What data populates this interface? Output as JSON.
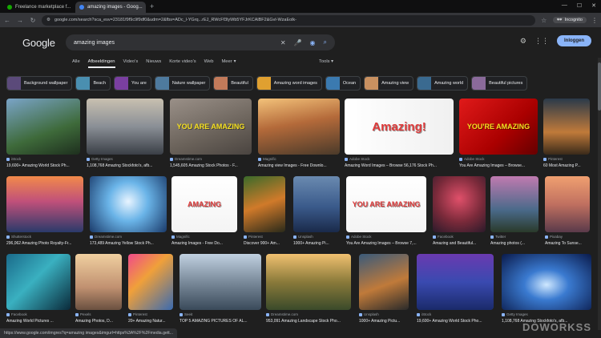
{
  "browser": {
    "tabs": [
      {
        "title": "Freelance marketplace f...",
        "favicon_color": "#14a800",
        "active": false
      },
      {
        "title": "amazing images - Goog...",
        "favicon_color": "#4285f4",
        "active": true
      }
    ],
    "new_tab": "+",
    "url": "google.com/search?sca_esv=23181f9f9c9f9df0&udm=2&fbs=ADc_l-YGrq...rEJ_RWcFf3lyWb5YFJrKCAlBF2&Gvl-WzaEolk-",
    "incognito_label": "Incognito"
  },
  "google": {
    "logo": "Google",
    "query": "amazing images",
    "signin": "Inloggen",
    "tabs": [
      "Alle",
      "Afbeeldingen",
      "Video's",
      "Nieuws",
      "Korte video's",
      "Web",
      "Meer"
    ],
    "active_tab": "Afbeeldingen",
    "tools": "Tools"
  },
  "chips": [
    {
      "label": "Background wallpaper",
      "color": "#5b4a7a"
    },
    {
      "label": "Beach",
      "color": "#4a8fb0"
    },
    {
      "label": "You are",
      "color": "#7a3fa0"
    },
    {
      "label": "Nature wallpaper",
      "color": "#4e7a9e"
    },
    {
      "label": "Beautiful",
      "color": "#c27a5a"
    },
    {
      "label": "Amazing word images",
      "color": "#e0a030"
    },
    {
      "label": "Ocean",
      "color": "#3b7ab0"
    },
    {
      "label": "Amazing view",
      "color": "#c89060"
    },
    {
      "label": "Amazing world",
      "color": "#3a6a90"
    },
    {
      "label": "Beautiful pictures",
      "color": "#8a6a9a"
    }
  ],
  "results": [
    {
      "source": "iStock",
      "title": "19,600+ Amazing World Stock Ph...",
      "grad": "linear-gradient(160deg,#7aa4c8,#3e6a3a 60%,#1e2f1e)"
    },
    {
      "source": "Getty Images",
      "title": "1,108,768 Amazing Stockfoto's, afb...",
      "grad": "linear-gradient(180deg,#c8c0b0,#8a8f96 50%,#3a3f46)"
    },
    {
      "source": "Dreamstime.com",
      "title": "1,545,605 Amazing Stock Photos - F...",
      "grad": "linear-gradient(160deg,#9a9088,#6a625a 60%,#4a4440)",
      "overlay": "YOU ARE AMAZING"
    },
    {
      "source": "Magnific",
      "title": "Amazing view Images - Free Downlo...",
      "grad": "linear-gradient(170deg,#f3c27a,#b46a3a 45%,#4a3a2a)"
    },
    {
      "source": "Adobe Stock",
      "title": "Amazing Word Images – Browse 56,176 Stock Ph...",
      "grad": "linear-gradient(90deg,#ffffff,#f0f0f0)",
      "overlay": "Amazing!"
    },
    {
      "source": "Adobe Stock",
      "title": "You Are Amazing Images – Browse...",
      "grad": "linear-gradient(135deg,#e01a1a,#a00 60%,#600)",
      "overlay": "YOU'RE AMAZING"
    },
    {
      "source": "Pinterest",
      "title": "60 Most Amazing P...",
      "grad": "linear-gradient(180deg,#2a3a4a,#c07a3a 60%,#3a2a1a)"
    },
    {
      "source": "Shutterstock",
      "title": "296,062 Amazing Photo Royalty-Fr...",
      "grad": "linear-gradient(180deg,#f28a4a,#c0507a 45%,#2a3a6a)"
    },
    {
      "source": "Dreamstime.com",
      "title": "173,489 Amazing Yellow Stock Ph...",
      "grad": "radial-gradient(circle at 50% 45%,#e8f4ff,#6ab4e8 40%,#1a3a6a)"
    },
    {
      "source": "Magnific",
      "title": "Amazing Images - Free Do...",
      "grad": "linear-gradient(180deg,#ffffff,#f4f4f4)",
      "overlay": "AMAZING"
    },
    {
      "source": "Pinterest",
      "title": "Discover 900+ Am...",
      "grad": "linear-gradient(160deg,#3a6a2a,#d07a2a 50%,#2a2a1a)"
    },
    {
      "source": "Unsplash",
      "title": "1000+ Amazing Pi...",
      "grad": "linear-gradient(180deg,#6a8ab0,#3a5a8a 55%,#1a2a4a)"
    },
    {
      "source": "Adobe Stock",
      "title": "You Are Amazing Images – Browse 7,...",
      "grad": "linear-gradient(180deg,#ffffff,#f4f4f4)",
      "overlay": "YOU ARE AMAZING"
    },
    {
      "source": "Facebook",
      "title": "Amazing and Beautiful...",
      "grad": "radial-gradient(circle at 50% 40%,#e0506a,#7a2a3a 55%,#2a1a2a)"
    },
    {
      "source": "Twitter",
      "title": "Amazing photos (...",
      "grad": "linear-gradient(180deg,#c07ab0,#4a6a8a 60%,#2a3a2a)"
    },
    {
      "source": "Pixabay",
      "title": "Amazing To Sunse...",
      "grad": "linear-gradient(180deg,#f0a070,#c07060 50%,#5a3a4a)"
    },
    {
      "source": "Facebook",
      "title": "Amazing World Pictures ...",
      "grad": "linear-gradient(135deg,#1a6a8a,#3ab0c0 45%,#0a2a3a)"
    },
    {
      "source": "Pexels",
      "title": "Amazing Photos, D...",
      "grad": "linear-gradient(180deg,#f0d0a0,#c09070 60%,#6a5040)"
    },
    {
      "source": "Pinterest",
      "title": "20+ Amazing Natur...",
      "grad": "linear-gradient(135deg,#f04a8a,#f0a03a 40%,#3a6ab0)"
    },
    {
      "source": "Seeit",
      "title": "TOP 5 AMAZING PICTURES OF AL...",
      "grad": "linear-gradient(180deg,#c0d0e0,#7a8a9a 50%,#3a4a5a)"
    },
    {
      "source": "Dreamstime.com",
      "title": "953,091 Amazing Landscape Stock Pho...",
      "grad": "linear-gradient(180deg,#f0c070,#8a7a3a 50%,#3a4a2a)"
    },
    {
      "source": "Unsplash",
      "title": "1000+ Amazing Pictu...",
      "grad": "linear-gradient(160deg,#3a5a7a,#c07a3a 55%,#2a2a2a)"
    },
    {
      "source": "iStock",
      "title": "19,600+ Amazing World Stock Pho...",
      "grad": "linear-gradient(180deg,#6a3ab0,#3a4ab0 50%,#1a2a6a)"
    },
    {
      "source": "Getty Images",
      "title": "1,108,768 Amazing Stockfoto's, afb...",
      "grad": "radial-gradient(ellipse at 50% 55%,#cfe8ff,#3a7ad0 35%,#0a1a4a)"
    }
  ],
  "status_url": "https://www.google.com/imgres?q=amazing images&imgurl=https%3A%2F%2Fmedia.gett...",
  "watermark": "DOWORKSS"
}
